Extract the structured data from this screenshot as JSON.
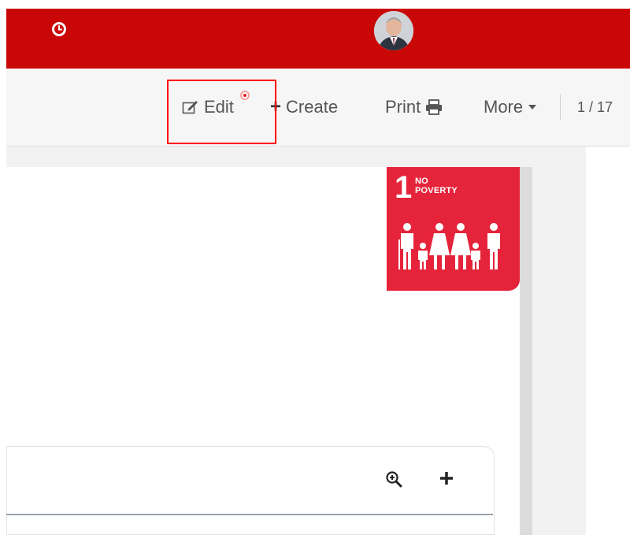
{
  "header": {
    "clock_icon": "clock-icon",
    "avatar": "user-avatar",
    "brand_color": "#c90707"
  },
  "toolbar": {
    "edit_label": "Edit",
    "create_label": "Create",
    "print_label": "Print",
    "more_label": "More",
    "pager": "1 / 17"
  },
  "sdg_card": {
    "number": "1",
    "title_line1": "NO",
    "title_line2": "POVERTY",
    "color": "#e5243b"
  },
  "panel": {
    "zoom_icon": "zoom-in-icon",
    "add_icon": "plus-icon"
  }
}
